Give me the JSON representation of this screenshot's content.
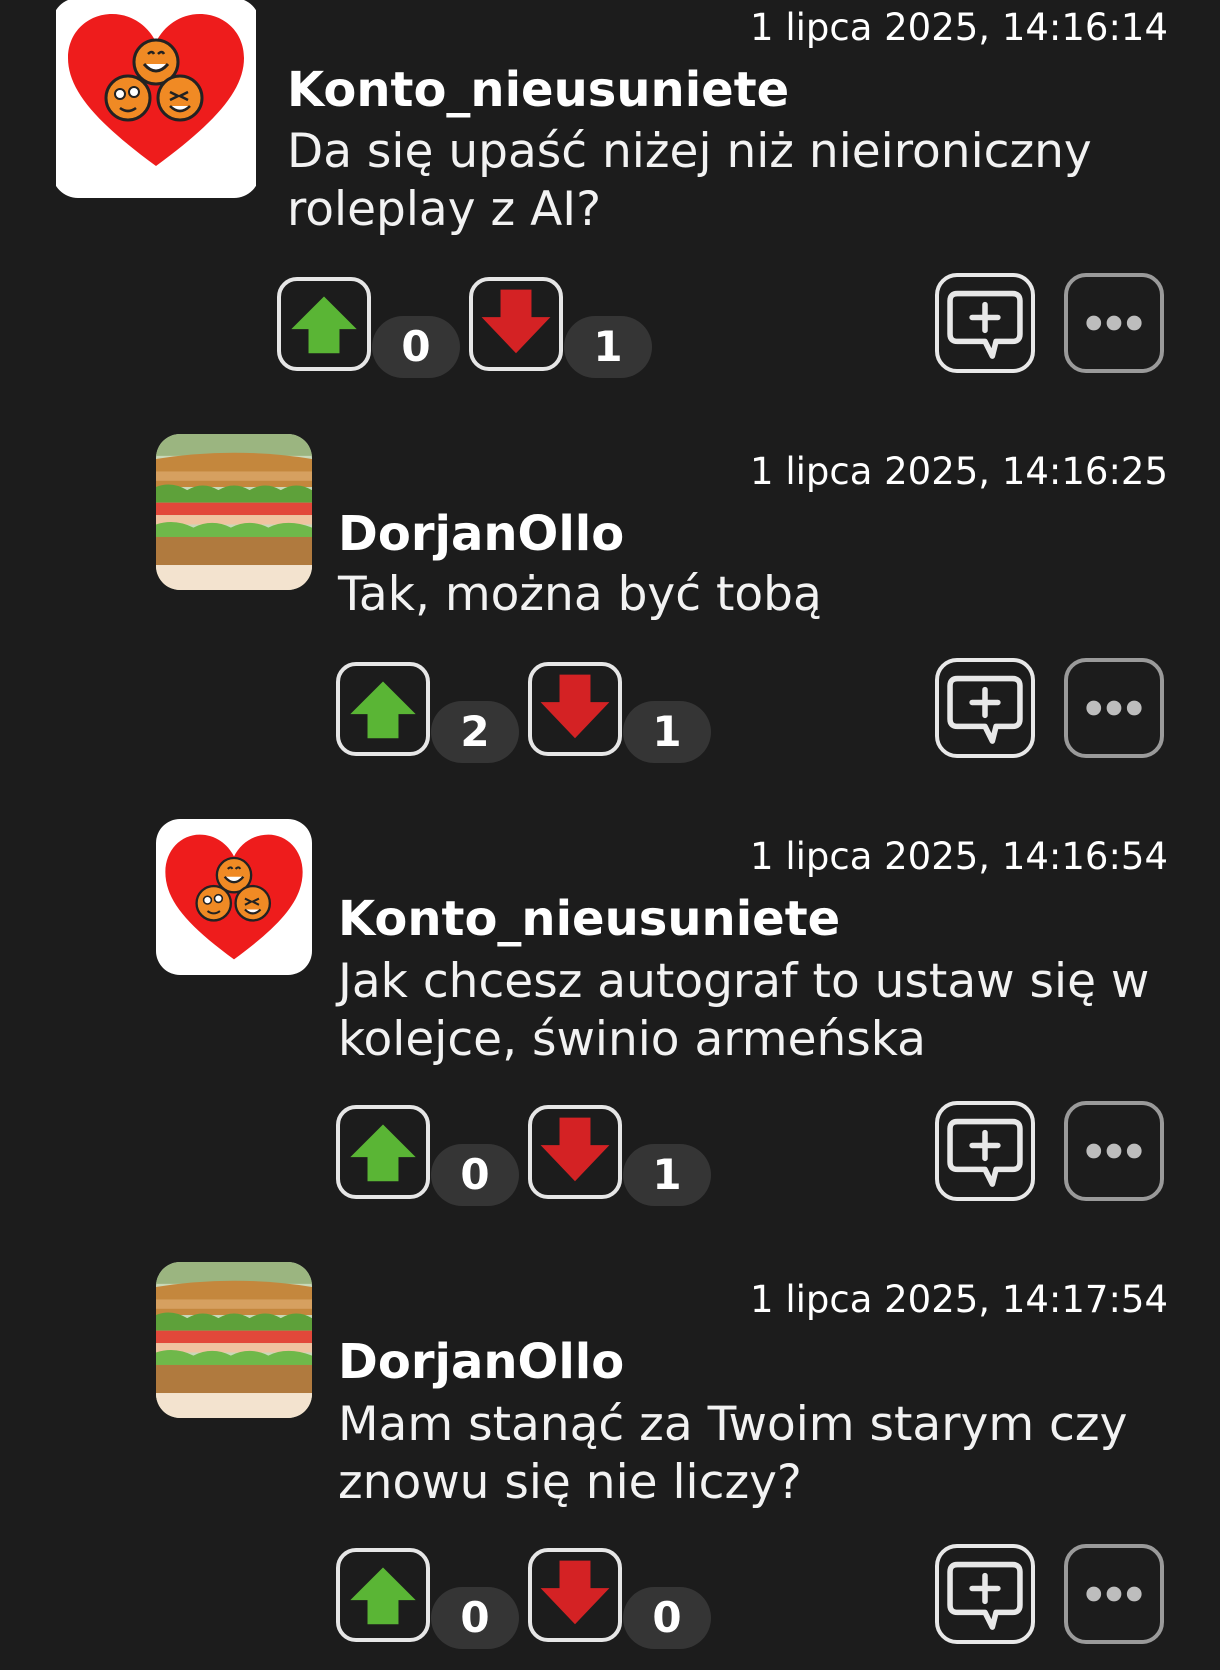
{
  "posts": [
    {
      "timestamp": "1 lipca 2025, 14:16:14",
      "username": "Konto_nieusuniete",
      "message": "Da się upaść niżej niż nieironiczny\nroleplay z AI?",
      "avatar": "heart-smileys-avatar",
      "upvotes": "0",
      "downvotes": "1"
    },
    {
      "timestamp": "1 lipca 2025, 14:16:25",
      "username": "DorjanOllo",
      "message": "Tak, można być tobą",
      "avatar": "sandwich-avatar",
      "upvotes": "2",
      "downvotes": "1"
    },
    {
      "timestamp": "1 lipca 2025, 14:16:54",
      "username": "Konto_nieusuniete",
      "message": "Jak chcesz autograf to ustaw się w\nkolejce, świnio armeńska",
      "avatar": "heart-smileys-avatar",
      "upvotes": "0",
      "downvotes": "1"
    },
    {
      "timestamp": "1 lipca 2025, 14:17:54",
      "username": "DorjanOllo",
      "message": "Mam stanąć za Twoim starym czy\nznowu się nie liczy?",
      "avatar": "sandwich-avatar",
      "upvotes": "0",
      "downvotes": "0"
    }
  ],
  "icons": {
    "upvote": "arrow-up-icon",
    "downvote": "arrow-down-icon",
    "reply": "add-comment-icon",
    "more": "more-dots-icon"
  },
  "colors": {
    "background": "#1c1c1c",
    "upvote": "#5ab535",
    "downvote": "#d42224",
    "count_pill": "#353535",
    "heart": "#ee1c1c"
  }
}
